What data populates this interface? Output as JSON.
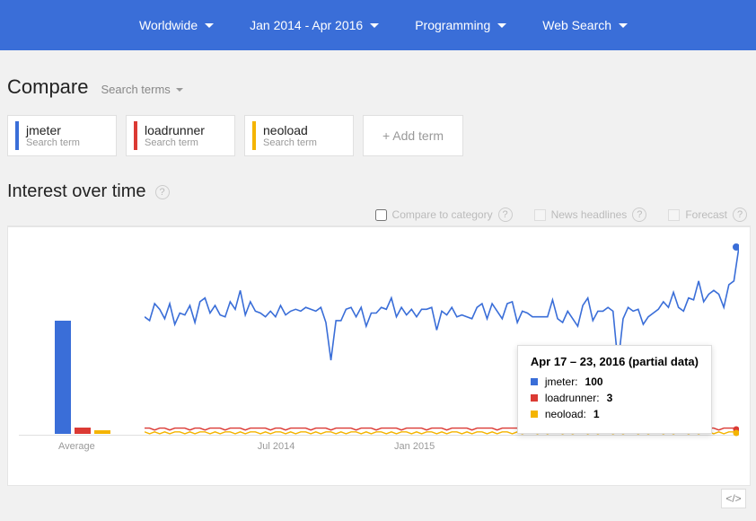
{
  "topbar": {
    "region": "Worldwide",
    "timerange": "Jan 2014 - Apr 2016",
    "category": "Programming",
    "searchtype": "Web Search"
  },
  "compare": {
    "title": "Compare",
    "subtitle": "Search terms",
    "add_label": "+ Add term",
    "terms": [
      {
        "name": "jmeter",
        "sub": "Search term",
        "color": "#3a6ed8"
      },
      {
        "name": "loadrunner",
        "sub": "Search term",
        "color": "#db3a34"
      },
      {
        "name": "neoload",
        "sub": "Search term",
        "color": "#f4b400"
      }
    ]
  },
  "section": {
    "title": "Interest over time",
    "opt_compare": "Compare to category",
    "opt_news": "News headlines",
    "opt_forecast": "Forecast"
  },
  "tooltip": {
    "title": "Apr 17 – 23, 2016 (partial data)",
    "rows": [
      {
        "label": "jmeter:",
        "value": "100",
        "color": "#3a6ed8"
      },
      {
        "label": "loadrunner:",
        "value": "3",
        "color": "#db3a34"
      },
      {
        "label": "neoload:",
        "value": "1",
        "color": "#f4b400"
      }
    ]
  },
  "axis": {
    "x1": "Jul 2014",
    "x2": "Jan 2015",
    "avg": "Average"
  },
  "embed": "</>",
  "chart_data": {
    "type": "line",
    "title": "Interest over time",
    "xlabel": "",
    "ylabel": "",
    "ylim": [
      0,
      100
    ],
    "x_ticks": [
      "Jul 2014",
      "Jan 2015"
    ],
    "average_bars": {
      "jmeter": 70,
      "loadrunner": 4,
      "neoload": 2
    },
    "series": [
      {
        "name": "jmeter",
        "color": "#3a6ed8",
        "values": [
          63,
          61,
          70,
          67,
          62,
          70,
          59,
          65,
          64,
          69,
          60,
          71,
          73,
          65,
          69,
          64,
          63,
          71,
          67,
          77,
          64,
          71,
          66,
          65,
          63,
          66,
          63,
          69,
          64,
          66,
          67,
          66,
          68,
          67,
          66,
          68,
          60,
          40,
          61,
          61,
          67,
          68,
          63,
          68,
          58,
          65,
          65,
          68,
          67,
          73,
          63,
          68,
          64,
          67,
          63,
          67,
          67,
          68,
          56,
          66,
          64,
          68,
          63,
          64,
          63,
          62,
          68,
          70,
          62,
          70,
          66,
          62,
          70,
          71,
          60,
          66,
          65,
          63,
          63,
          63,
          63,
          72,
          62,
          60,
          66,
          62,
          58,
          69,
          73,
          61,
          66,
          66,
          68,
          66,
          38,
          62,
          68,
          66,
          67,
          59,
          63,
          65,
          67,
          71,
          68,
          76,
          68,
          66,
          73,
          72,
          82,
          71,
          75,
          77,
          75,
          68,
          80,
          82,
          100
        ]
      },
      {
        "name": "loadrunner",
        "color": "#db3a34",
        "values": [
          4,
          4,
          3,
          4,
          4,
          3,
          4,
          4,
          4,
          3,
          4,
          4,
          3,
          4,
          4,
          4,
          3,
          4,
          4,
          4,
          3,
          4,
          4,
          4,
          4,
          3,
          4,
          4,
          3,
          4,
          4,
          4,
          4,
          3,
          4,
          4,
          4,
          3,
          4,
          4,
          4,
          4,
          3,
          4,
          4,
          4,
          3,
          4,
          4,
          4,
          4,
          3,
          4,
          4,
          4,
          4,
          3,
          4,
          4,
          4,
          3,
          4,
          4,
          4,
          4,
          3,
          4,
          4,
          4,
          4,
          3,
          4,
          4,
          4,
          4,
          3,
          4,
          4,
          4,
          3,
          4,
          4,
          4,
          4,
          3,
          4,
          4,
          3,
          4,
          4,
          4,
          4,
          3,
          4,
          4,
          4,
          3,
          4,
          4,
          4,
          4,
          3,
          4,
          4,
          4,
          3,
          4,
          4,
          4,
          4,
          3,
          4,
          4,
          4,
          3,
          4,
          4,
          4,
          3
        ]
      },
      {
        "name": "neoload",
        "color": "#f4b400",
        "values": [
          2,
          1,
          2,
          1,
          2,
          1,
          2,
          2,
          1,
          2,
          1,
          2,
          2,
          1,
          2,
          1,
          2,
          2,
          1,
          2,
          1,
          2,
          2,
          1,
          2,
          1,
          2,
          2,
          1,
          2,
          1,
          2,
          2,
          1,
          2,
          1,
          2,
          2,
          1,
          2,
          1,
          2,
          2,
          1,
          2,
          1,
          2,
          2,
          1,
          2,
          1,
          2,
          2,
          1,
          2,
          1,
          2,
          2,
          1,
          2,
          1,
          2,
          2,
          1,
          2,
          1,
          2,
          2,
          1,
          2,
          1,
          2,
          2,
          1,
          2,
          1,
          2,
          2,
          1,
          2,
          1,
          2,
          2,
          1,
          2,
          1,
          2,
          2,
          1,
          2,
          1,
          2,
          2,
          1,
          2,
          1,
          2,
          2,
          1,
          2,
          1,
          2,
          2,
          1,
          2,
          1,
          2,
          2,
          1,
          2,
          1,
          2,
          2,
          1,
          2,
          1,
          2,
          2,
          1
        ]
      }
    ]
  }
}
